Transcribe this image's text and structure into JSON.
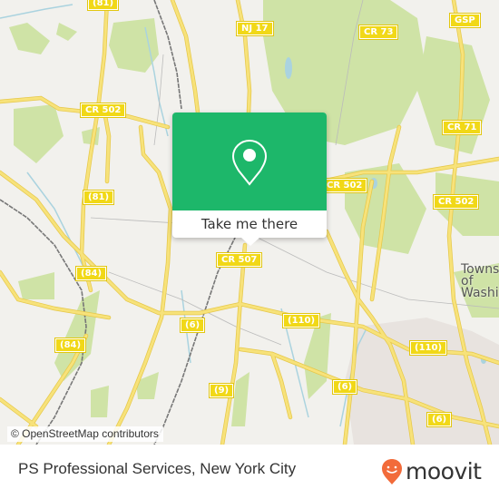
{
  "map": {
    "attribution": "© OpenStreetMap contributors",
    "colors": {
      "land": "#f2f1ed",
      "road": "#f7e27a",
      "road_casing": "#e6c84a",
      "park": "#cfe3a6",
      "water": "#aad3df",
      "rail": "#777777",
      "urban": "#e6e0dc"
    },
    "road_labels": [
      {
        "text": "(81)"
      },
      {
        "text": "NJ 17"
      },
      {
        "text": "CR 73"
      },
      {
        "text": "GSP"
      },
      {
        "text": "CR 502"
      },
      {
        "text": "CR 71"
      },
      {
        "text": "(81)"
      },
      {
        "text": "CR 502"
      },
      {
        "text": "CR 502"
      },
      {
        "text": "CR 507"
      },
      {
        "text": "(84)"
      },
      {
        "text": "(6)"
      },
      {
        "text": "(110)"
      },
      {
        "text": "(84)"
      },
      {
        "text": "(110)"
      },
      {
        "text": "(9)"
      },
      {
        "text": "(6)"
      },
      {
        "text": "(6)"
      }
    ],
    "place_labels": [
      {
        "line1": "Towns",
        "line2": "of Washin"
      }
    ]
  },
  "popup": {
    "icon": "map-pin-icon",
    "button_label": "Take me there",
    "accent_color": "#1db76a"
  },
  "footer": {
    "title": "PS Professional Services, New York City",
    "brand": "moovit",
    "brand_color": "#f26b3a"
  }
}
